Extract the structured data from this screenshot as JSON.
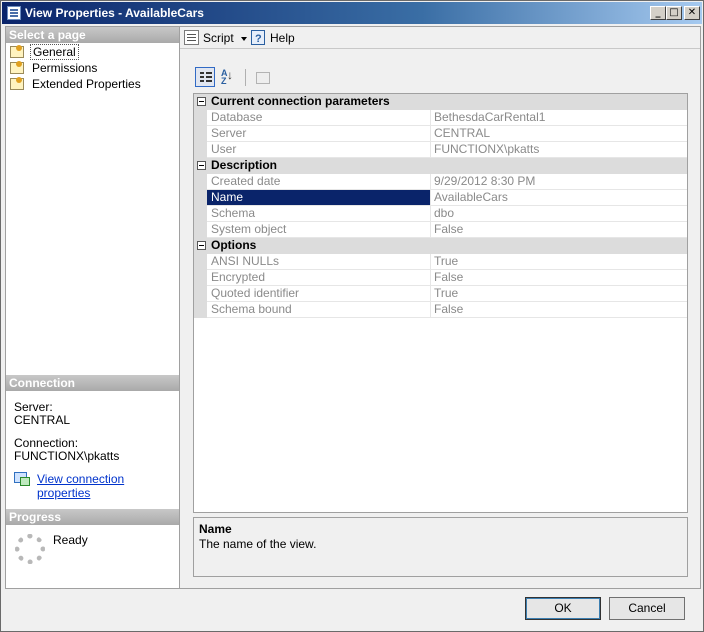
{
  "window": {
    "title": "View Properties - AvailableCars"
  },
  "left": {
    "select_header": "Select a page",
    "pages": [
      {
        "label": "General",
        "selected": true
      },
      {
        "label": "Permissions",
        "selected": false
      },
      {
        "label": "Extended Properties",
        "selected": false
      }
    ],
    "connection_header": "Connection",
    "server_label": "Server:",
    "server_value": "CENTRAL",
    "connection_label": "Connection:",
    "connection_value": "FUNCTIONX\\pkatts",
    "view_connection_link": "View connection properties",
    "progress_header": "Progress",
    "progress_status": "Ready"
  },
  "toolbar": {
    "script_label": "Script",
    "help_label": "Help"
  },
  "grid": {
    "categories": [
      {
        "label": "Current connection parameters",
        "rows": [
          {
            "name": "Database",
            "value": "BethesdaCarRental1"
          },
          {
            "name": "Server",
            "value": "CENTRAL"
          },
          {
            "name": "User",
            "value": "FUNCTIONX\\pkatts"
          }
        ]
      },
      {
        "label": "Description",
        "rows": [
          {
            "name": "Created date",
            "value": "9/29/2012 8:30 PM"
          },
          {
            "name": "Name",
            "value": "AvailableCars",
            "selected": true
          },
          {
            "name": "Schema",
            "value": "dbo"
          },
          {
            "name": "System object",
            "value": "False"
          }
        ]
      },
      {
        "label": "Options",
        "rows": [
          {
            "name": "ANSI NULLs",
            "value": "True"
          },
          {
            "name": "Encrypted",
            "value": "False"
          },
          {
            "name": "Quoted identifier",
            "value": "True"
          },
          {
            "name": "Schema bound",
            "value": "False"
          }
        ]
      }
    ]
  },
  "description": {
    "title": "Name",
    "body": "The name of the view."
  },
  "buttons": {
    "ok": "OK",
    "cancel": "Cancel"
  }
}
